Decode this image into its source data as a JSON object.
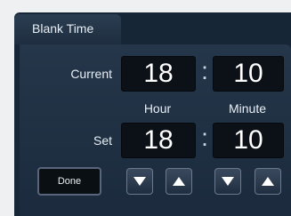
{
  "tab": {
    "title": "Blank Time"
  },
  "current": {
    "label": "Current",
    "hour": "18",
    "minute": "10"
  },
  "columns": {
    "hour": "Hour",
    "minute": "Minute"
  },
  "set": {
    "label": "Set",
    "hour": "18",
    "minute": "10"
  },
  "separator": ":",
  "buttons": {
    "done": "Done",
    "hour_down_icon": "arrow-down-icon",
    "hour_up_icon": "arrow-up-icon",
    "minute_down_icon": "arrow-down-icon",
    "minute_up_icon": "arrow-up-icon"
  },
  "colors": {
    "background": "#172636",
    "digit_bg": "#0c1117",
    "text": "#e8eef5"
  }
}
